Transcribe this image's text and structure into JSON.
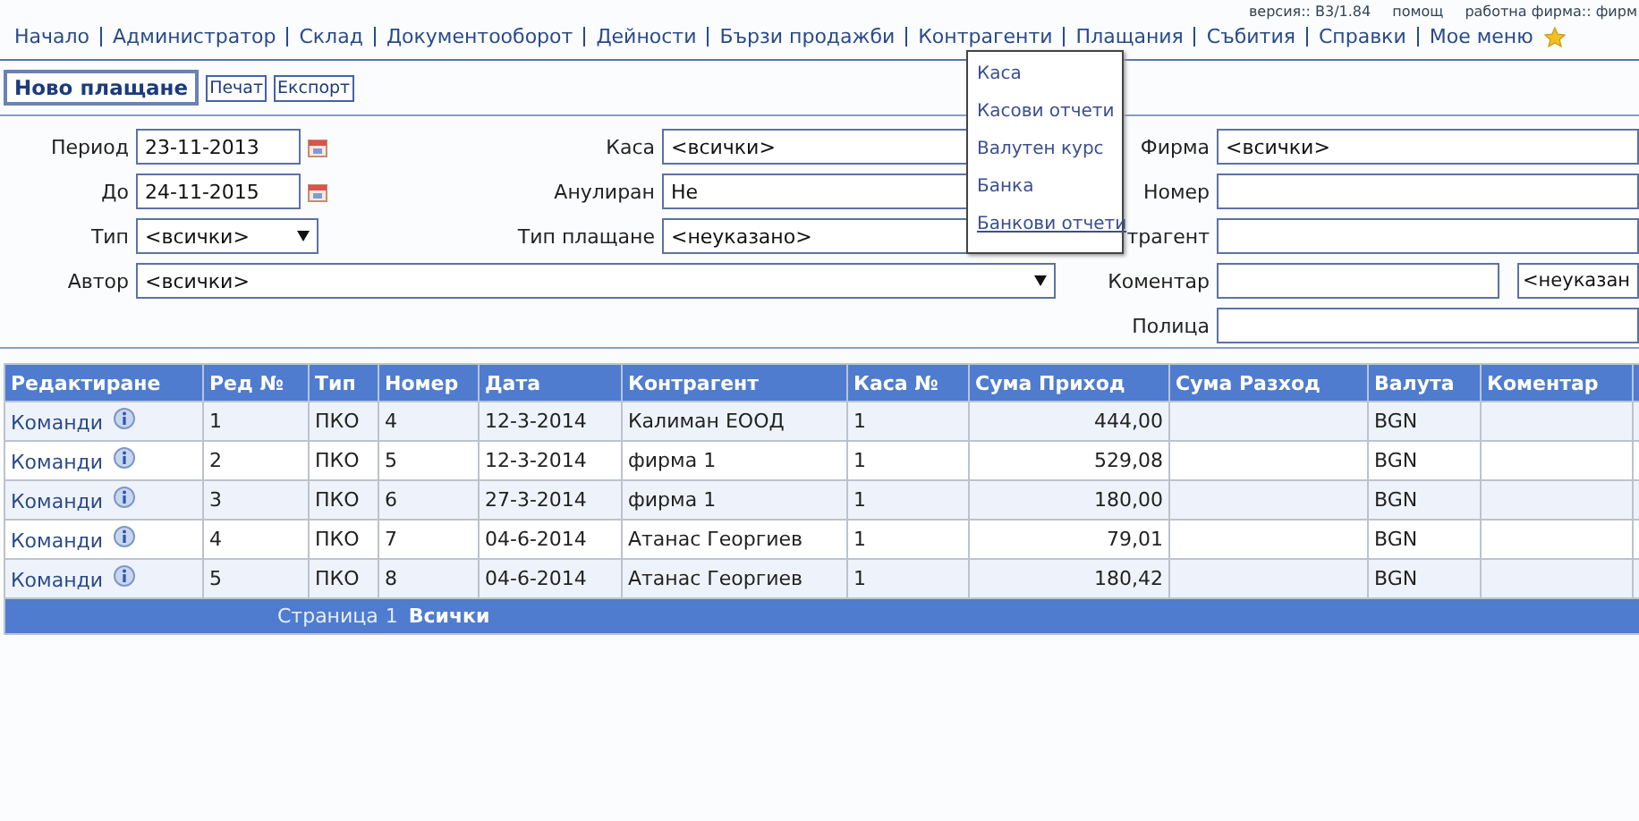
{
  "header": {
    "version": "версия:: B3/1.84",
    "help": "помощ",
    "company": "работна фирма:: фирм"
  },
  "nav": [
    {
      "label": "Начало"
    },
    {
      "label": "Администратор"
    },
    {
      "label": "Склад"
    },
    {
      "label": "Документооборот"
    },
    {
      "label": "Дейности"
    },
    {
      "label": "Бързи продажби"
    },
    {
      "label": "Контрагенти"
    },
    {
      "label": "Плащания"
    },
    {
      "label": "Събития"
    },
    {
      "label": "Справки"
    },
    {
      "label": "Мое меню"
    }
  ],
  "toolbar": [
    {
      "label": "Ново плащане",
      "kind": "primary"
    },
    {
      "label": "Печат",
      "kind": "small"
    },
    {
      "label": "Експорт",
      "kind": "small"
    }
  ],
  "menu": [
    {
      "label": "Каса",
      "selected": false
    },
    {
      "label": "Касови отчети",
      "selected": false
    },
    {
      "label": "Валутен курс",
      "selected": false
    },
    {
      "label": "Банка",
      "selected": false
    },
    {
      "label": "Банкови отчети",
      "selected": true
    }
  ],
  "filters": [
    {
      "left": {
        "label": "Период",
        "kind": "date",
        "value": "23-11-2013"
      },
      "middle": {
        "label": "Каса",
        "kind": "select",
        "value": "<всички>"
      },
      "right": {
        "label": "Фирма",
        "kind": "select",
        "value": "<всички>"
      }
    },
    {
      "left": {
        "label": "До",
        "kind": "date",
        "value": "24-11-2015"
      },
      "middle": {
        "label": "Анулиран",
        "kind": "select",
        "value": "Не"
      },
      "right": {
        "label": "Номер",
        "kind": "input"
      }
    },
    {
      "left": {
        "label": "Тип",
        "kind": "dropdown",
        "value": "<всички>"
      },
      "middle": {
        "label": "Тип плащане",
        "kind": "select",
        "value": "<неуказано>"
      },
      "right": {
        "label": "трагент",
        "kind": "input"
      }
    },
    {
      "left": {
        "label": "Автор",
        "kind": "wide-dropdown",
        "value": "<всички>"
      },
      "right": {
        "label": "Коментар",
        "kind": "input-select",
        "extra": "<неуказан"
      }
    },
    {
      "right": {
        "label": "Полица",
        "kind": "input"
      }
    }
  ],
  "table": {
    "columns": [
      "Редактиране",
      "Ред №",
      "Тип",
      "Номер",
      "Дата",
      "Контрагент",
      "Каса №",
      "Сума Приход",
      "Сума Разход",
      "Валута",
      "Коментар"
    ],
    "rows": [
      [
        "Команди",
        "1",
        "ПКО",
        "4",
        "12-3-2014",
        "Калиман ЕООД",
        "1",
        "444,00",
        "",
        "BGN",
        ""
      ],
      [
        "Команди",
        "2",
        "ПКО",
        "5",
        "12-3-2014",
        "фирма 1",
        "1",
        "529,08",
        "",
        "BGN",
        ""
      ],
      [
        "Команди",
        "3",
        "ПКО",
        "6",
        "27-3-2014",
        "фирма 1",
        "1",
        "180,00",
        "",
        "BGN",
        ""
      ],
      [
        "Команди",
        "4",
        "ПКО",
        "7",
        "04-6-2014",
        "Атанас Георгиев",
        "1",
        "79,01",
        "",
        "BGN",
        ""
      ],
      [
        "Команди",
        "5",
        "ПКО",
        "8",
        "04-6-2014",
        "Атанас Георгиев",
        "1",
        "180,42",
        "",
        "BGN",
        ""
      ]
    ],
    "pager": {
      "label": "Страница",
      "page": "1",
      "all": "Всички"
    }
  }
}
